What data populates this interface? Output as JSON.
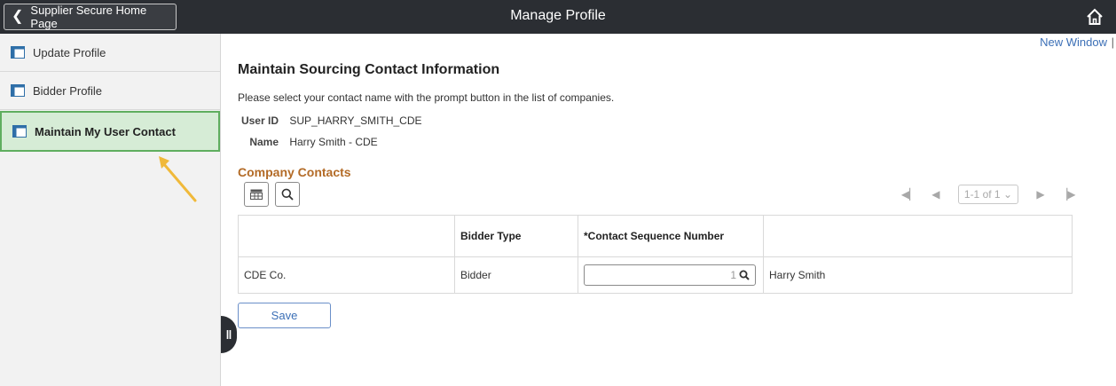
{
  "header": {
    "back_label": "Supplier Secure Home Page",
    "title": "Manage Profile"
  },
  "sidebar": {
    "items": [
      {
        "label": "Update Profile"
      },
      {
        "label": "Bidder Profile"
      },
      {
        "label": "Maintain My User Contact"
      }
    ]
  },
  "main": {
    "new_window": "New Window",
    "separator": "|",
    "heading": "Maintain Sourcing Contact Information",
    "instructions": "Please select your contact name with the prompt button in the list of companies.",
    "user_id_label": "User ID",
    "user_id_value": "SUP_HARRY_SMITH_CDE",
    "name_label": "Name",
    "name_value": "Harry Smith - CDE",
    "section_title": "Company Contacts",
    "pager": {
      "range": "1-1 of 1"
    },
    "table": {
      "headers": [
        "",
        "Bidder Type",
        "*Contact Sequence Number",
        ""
      ],
      "rows": [
        {
          "company": "CDE Co.",
          "bidder_type": "Bidder",
          "seq": "1",
          "contact": "Harry Smith"
        }
      ]
    },
    "save_label": "Save"
  },
  "colors": {
    "topbar": "#2b2e33",
    "active_item_bg": "#d6ecd6",
    "active_item_border": "#5fae5f",
    "section_title": "#b36b27",
    "link": "#3b6fb6",
    "annotation_arrow": "#f0b93a"
  }
}
